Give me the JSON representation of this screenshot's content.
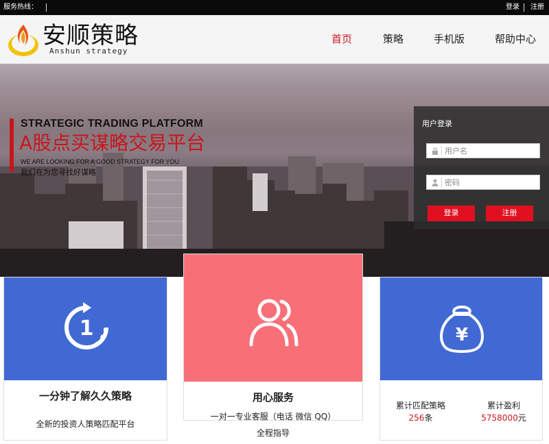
{
  "topbar": {
    "hotline_label": "服务热线：",
    "login": "登录",
    "register": "注册"
  },
  "header": {
    "logo_title": "安顺策略",
    "logo_subtitle": "Anshun strategy",
    "nav": [
      {
        "label": "首页",
        "active": true
      },
      {
        "label": "策略",
        "active": false
      },
      {
        "label": "手机版",
        "active": false
      },
      {
        "label": "帮助中心",
        "active": false
      }
    ]
  },
  "hero": {
    "headline_en": "STRATEGIC TRADING PLATFORM",
    "headline_cn": "A股点买谋略交易平台",
    "tagline_en": "WE ARE LOOKING FOR A GOOD STRATEGY FOR YOU",
    "tagline_cn": "我们在为您寻找好谋略"
  },
  "login_panel": {
    "title": "用户登录",
    "username_placeholder": "用户名",
    "password_placeholder": "密码",
    "login_button": "登录",
    "register_button": "注册"
  },
  "cards": [
    {
      "icon": "one-minute-icon",
      "title": "一分钟了解久久策略",
      "text": "全新的投资人策略匹配平台",
      "color": "#4169d4"
    },
    {
      "icon": "users-icon",
      "title": "用心服务",
      "text_line1": "一对一专业客服（电话 微信 QQ）",
      "text_line2": "全程指导",
      "color": "#f87077"
    },
    {
      "icon": "money-bag-icon",
      "stat1_label": "累计匹配策略",
      "stat1_value": "256",
      "stat1_unit": "条",
      "stat2_label": "累计盈利",
      "stat2_value": "5758000",
      "stat2_unit": "元",
      "color": "#4169d4"
    }
  ],
  "colors": {
    "accent_red": "#d0171f",
    "card_blue": "#4169d4",
    "card_pink": "#f87077"
  }
}
